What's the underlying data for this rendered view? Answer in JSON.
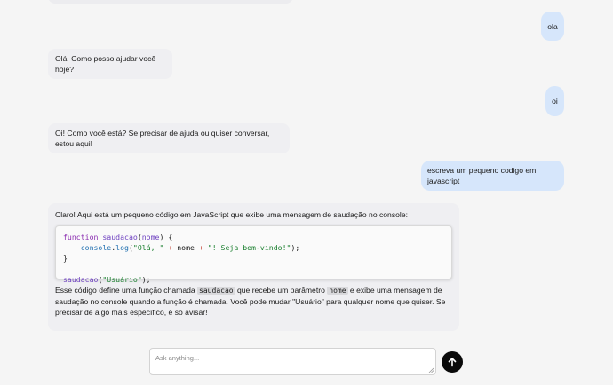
{
  "messages": [
    {
      "role": "user",
      "text": "ola"
    },
    {
      "role": "assistant",
      "text": "Olá! Como posso ajudar você hoje?"
    },
    {
      "role": "user",
      "text": "oi"
    },
    {
      "role": "assistant",
      "text": "Oi! Como você está? Se precisar de ajuda ou quiser conversar, estou aqui!"
    },
    {
      "role": "user",
      "text": "escreva um pequeno codigo em javascript"
    },
    {
      "role": "assistant",
      "intro": "Claro! Aqui está um pequeno código em JavaScript que exibe uma mensagem de saudação no console:",
      "code": {
        "line1_kw": "function",
        "line1_fn": "saudacao",
        "line1_open": "(",
        "line1_param": "nome",
        "line1_close": ") {",
        "line2_obj": "console",
        "line2_dot": ".",
        "line2_method": "log",
        "line2_open": "(",
        "line2_str1": "\"Olá, \"",
        "line2_plus1": "+",
        "line2_var": "nome",
        "line2_plus2": "+",
        "line2_str2": "\"! Seja bem-vindo!\"",
        "line2_close": ");",
        "line3": "}",
        "line5_fn": "saudacao",
        "line5_open": "(",
        "line5_str": "\"Usuário\"",
        "line5_close": ");"
      },
      "outro_part1": "Esse código define uma função chamada",
      "outro_code1": "saudacao",
      "outro_part2": "que recebe um parâmetro",
      "outro_code2": "nome",
      "outro_part3": "e exibe uma mensagem de saudação no console quando a função é chamada. Você pode mudar \"Usuário\" para qualquer nome que quiser. Se precisar de algo mais específico, é só avisar!"
    }
  ],
  "composer": {
    "placeholder": "Ask anything...",
    "value": ""
  },
  "send_button": {
    "icon": "arrow-up-icon"
  },
  "colors": {
    "background": "#f5f5f5",
    "user_bubble": "#d6e6fb",
    "assistant_bubble": "#efeff2",
    "send_button": "#0a0a0a"
  }
}
